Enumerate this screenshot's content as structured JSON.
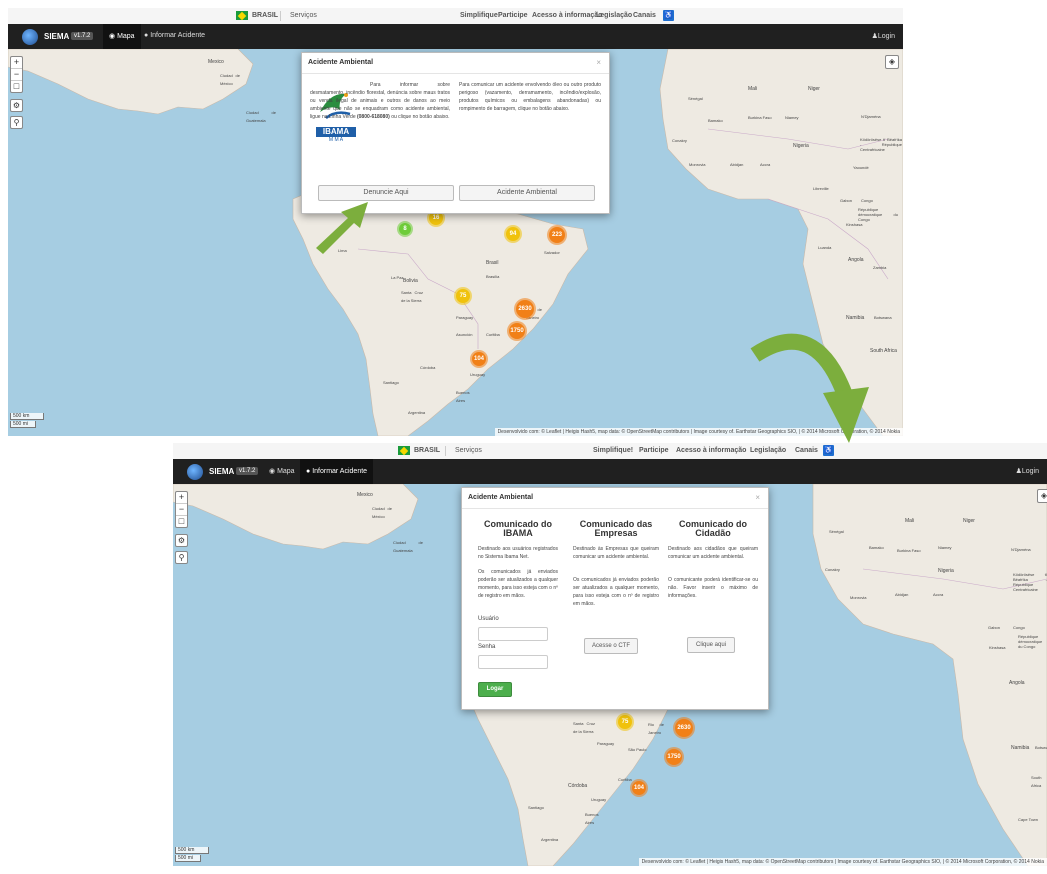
{
  "gov": {
    "country": "BRASIL",
    "services": "Serviços",
    "links": [
      "Simplifique!",
      "Participe",
      "Acesso à informação",
      "Legislação",
      "Canais"
    ]
  },
  "app": {
    "brand": "SIEMA",
    "version": "v1.7.2",
    "nav_map": "Mapa",
    "nav_report": "Informar Acidente",
    "login": "Login"
  },
  "map": {
    "labels": {
      "mexico": "Mexico",
      "cidade_mexico": "Ciudad de México",
      "guatemala": "Ciudad de Guatemala",
      "bolivia": "Bolivia",
      "lima": "Lima",
      "lapaz": "La Paz",
      "brasil": "Brasil",
      "brasilia": "Brasília",
      "salvador": "Salvador",
      "rio": "Rio de Janeiro",
      "sao_paulo": "São Paulo",
      "curitiba": "Curitiba",
      "asuncion": "Asunción",
      "paraguay": "Paraguay",
      "cordoba": "Córdoba",
      "santiago": "Santiago",
      "buenos_aires": "Buenos Aires",
      "argentina": "Argentina",
      "uruguay": "Uruguay",
      "santa_cruz": "Santa Cruz de la Sierra",
      "mali": "Mali",
      "niger": "Niger",
      "nigeria": "Nigeria",
      "bamako": "Bamako",
      "senegal": "Sénégal",
      "conakry": "Conakry",
      "monrovia": "Monrovia",
      "abidjan": "Abidjan",
      "accra": "Accra",
      "niamey": "Niamey",
      "ndjamena": "N'Djaména",
      "yaounde": "Yaoundé",
      "gabon": "Gabon",
      "congo": "Congo",
      "kinshasa": "Kinshasa",
      "rd_congo": "République démocratique du Congo",
      "angola": "Angola",
      "luanda": "Luanda",
      "zambia": "Zambia",
      "namibia": "Namibia",
      "botswana": "Botswana",
      "south_africa": "South Africa",
      "cape_town": "Cape Town",
      "libreville": "Libreville",
      "centrafrique": "Ködörösêse tî Bêafrîka - République Centrafricaine",
      "burkina": "Burkina Faso"
    },
    "clusters": {
      "c8": "8",
      "c16": "16",
      "c94": "94",
      "c223": "223",
      "c75": "75",
      "c2630": "2630",
      "c1750": "1750",
      "c104": "104"
    },
    "scale_km": "500 km",
    "scale_mi": "500 mi",
    "attribution_top": "Desenvolvido com: © Leaflet | Heigis Hash5, map data: © OpenStreetMap contributors | Image courtesy of. Earthstar Geographics SIO, | © 2014 Microsoft Corporation, © 2014 Nokia",
    "attribution_bottom": "Desenvolvido com: © Leaflet | Heigis Hash5, map data: © OpenStreetMap contributors | Image courtesy of. Earthstar Geographics SIO, | © 2014 Microsoft Corporation, © 2014 Nokia"
  },
  "modal1": {
    "title": "Acidente Ambiental",
    "close": "×",
    "logo_text": "IBAMA",
    "logo_sub": "M M A",
    "left_text": "Para informar sobre desmatamento, incêndio florestal, denúncia sobre maus tratos ou venda ilegal de animais e outros de danos ao meio ambiente que não se enquadram como acidente ambiental, ligue na Linha Verde",
    "phone": "(0800-618080)",
    "left_text_tail": "ou clique no botão abaixo.",
    "right_text": "Para comunicar um acidente envolvendo óleo ou outro produto perigoso (vazamento, derramamento, incêndio/explosão, produtos químicos ou embalagens abandonadas) ou rompimento de barragem, clique no botão abaixo.",
    "btn_denuncie": "Denuncie Aqui",
    "btn_acidente": "Acidente Ambiental"
  },
  "modal2": {
    "title": "Acidente Ambiental",
    "close": "×",
    "col1": {
      "title": "Comunicado do IBAMA",
      "p1": "Destinado aos usuários registrados no Sistema Ibama Net.",
      "p2": "Os comunicados já enviados poderão ser atualizados a qualquer momento, para isso esteja com o nº de registro em mãos.",
      "user_label": "Usuário",
      "pass_label": "Senha",
      "login_btn": "Logar"
    },
    "col2": {
      "title": "Comunicado das Empresas",
      "p1": "Destinado às Empresas que queiram comunicar um acidente ambiental.",
      "p2": "Os comunicados já enviados poderão ser atualizados a qualquer momento, para isso esteja com o nº de registro em mãos.",
      "btn": "Acesse o CTF"
    },
    "col3": {
      "title": "Comunicado do Cidadão",
      "p1": "Destinado aos cidadãos que queiram comunicar um acidente ambiental.",
      "p2": "O comunicante poderá identificar-se ou não. Favor inserir o máximo de informações.",
      "btn": "Clique aqui"
    }
  },
  "colors": {
    "ocean": "#a6cde2",
    "land": "#eeeae2",
    "arrow": "#7cae3d",
    "nav": "#202020",
    "green_btn": "#4cae4c"
  }
}
